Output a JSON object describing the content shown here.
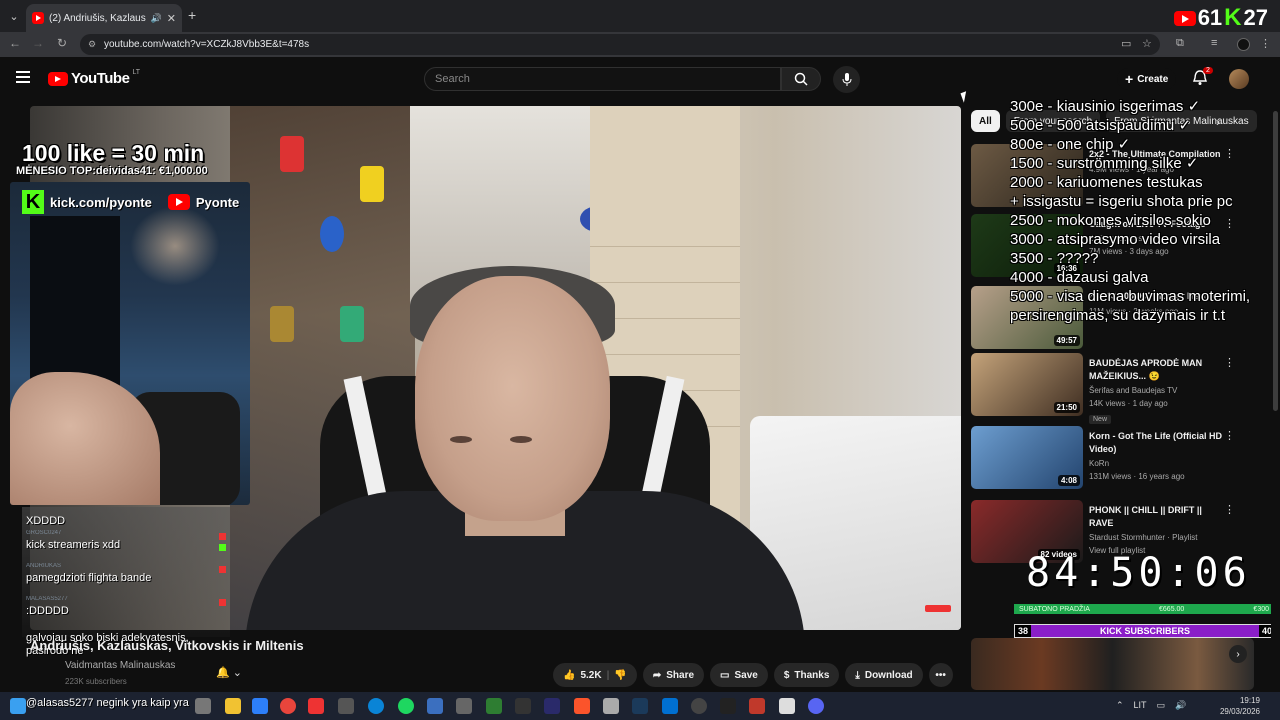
{
  "browser": {
    "tab_title": "(2) Andriušis, Kazlauskas, Vi",
    "url": "youtube.com/watch?v=XCZkJ8Vbb3E&t=478s",
    "overlay_logo": "61"
  },
  "header": {
    "logo_text": "YouTube",
    "region": "LT",
    "search_placeholder": "Search",
    "create_label": "Create",
    "notifications_count": "2"
  },
  "overlay": {
    "like_text": "100 like = 30 min",
    "top_donor": "MĖNESIO TOP:deividas41: €1,000.00",
    "kick_handle": "kick.com/pyonte",
    "yt_handle": "Pyonte",
    "chat": [
      {
        "user": "ANDRIUKAS",
        "text": "XDDDD"
      },
      {
        "user": "GROSC0247",
        "text": "kick streameris xdd"
      },
      {
        "user": "ANDRIUKAS",
        "text": "pamegdzioti flighta bande"
      },
      {
        "user": "MALASAS5277",
        "text": ":DDDDD"
      },
      {
        "user": "",
        "text": "galvojau soko biski adekvatesnis,"
      },
      {
        "user": "",
        "text": "pasirodo ne"
      }
    ],
    "goals": [
      "300e - kiausinio isgerimas ✓",
      "500e - 500 atsispaudimu ✓",
      "800e - one chip ✓",
      "1500 - surströmming silke ✓",
      "2000 - kariuomenes testukas",
      "+ issigastu = isgeriu shota prie pc",
      "2500 - mokomes virsilos sokio",
      "3000 - atsiprasymo video virsila",
      "3500 - ?????",
      "4000 - dazausi galva",
      "5000 - visa diena buvimas moterimi,",
      "persirengimas, su dazymais ir t.t"
    ],
    "timer": "84:50:06",
    "subgoal_left": "SUBATONO PRADŽIA",
    "subgoal_mid": "€665.00",
    "subgoal_right": "€300",
    "kick_subs_count": "38",
    "kick_subs_label": "KICK SUBSCRIBERS",
    "kick_subs_goal": "40",
    "taskbar_chat": "@alasas5277 negink yra kaip yra"
  },
  "video": {
    "title": "Andriušis, Kazlauskas, Vitkovskis ir Miltenis",
    "channel": "Vaidmantas Malinauskas",
    "subscribers": "223K subscribers",
    "likes": "5.2K",
    "actions": {
      "share": "Share",
      "save": "Save",
      "thanks": "Thanks",
      "download": "Download"
    }
  },
  "sidebar": {
    "chips": [
      "All",
      "From your search",
      "From Skirmantas Malinauskas"
    ],
    "recommendations": [
      {
        "title": "2x2 - The Ultimate Compilation",
        "channel": "",
        "meta": "4.9M views · 1 year ago",
        "duration": "",
        "new": ""
      },
      {
        "title": "Caught on Live TV Footage",
        "channel": "Chilling Scares",
        "meta": "7M views · 3 days ago",
        "duration": "16:36",
        "new": ""
      },
      {
        "title": "Her $3,000,000 Murder Mansion",
        "channel": "",
        "meta": "11M views · 2 weeks ago",
        "duration": "49:57",
        "new": ""
      },
      {
        "title": "BAUDĖJAS APRODĖ MAN MAŽEIKIUS... 😉",
        "channel": "Šerifas and Baudejas TV",
        "meta": "14K views · 1 day ago",
        "duration": "21:50",
        "new": "New"
      },
      {
        "title": "Korn - Got The Life (Official HD Video)",
        "channel": "KoRn",
        "meta": "131M views · 16 years ago",
        "duration": "4:08",
        "new": ""
      },
      {
        "title": "PHONK || CHILL || DRIFT || RAVE",
        "channel": "Stardust Stormhunter · Playlist",
        "meta": "View full playlist",
        "duration": "82 videos",
        "new": ""
      }
    ]
  },
  "taskbar": {
    "time": "19:19",
    "date": "29/03/2026",
    "lang": "LIT"
  }
}
